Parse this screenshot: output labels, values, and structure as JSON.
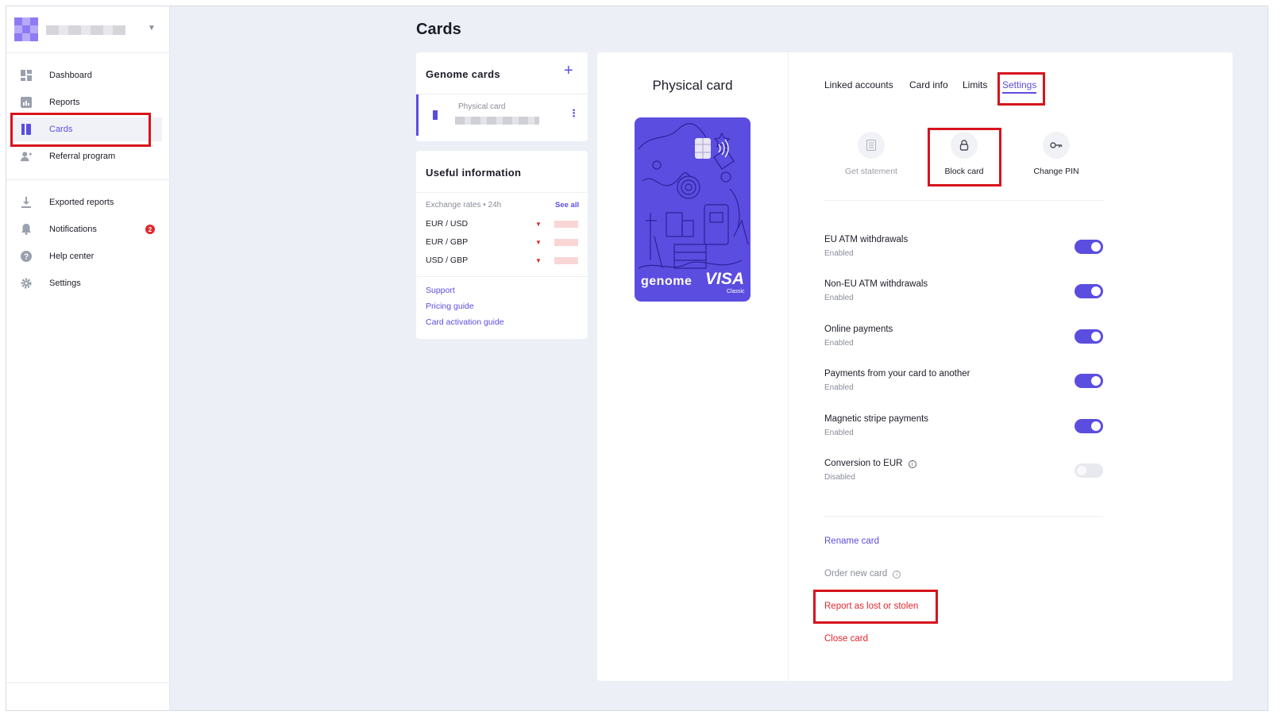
{
  "sidebar": {
    "nav_primary": [
      {
        "label": "Dashboard",
        "icon": "dashboard-icon"
      },
      {
        "label": "Reports",
        "icon": "reports-icon"
      },
      {
        "label": "Cards",
        "icon": "cards-icon",
        "active": true
      },
      {
        "label": "Referral program",
        "icon": "referral-icon"
      }
    ],
    "nav_secondary": [
      {
        "label": "Exported reports",
        "icon": "download-icon"
      },
      {
        "label": "Notifications",
        "icon": "bell-icon",
        "badge": "2"
      },
      {
        "label": "Help center",
        "icon": "help-icon"
      },
      {
        "label": "Settings",
        "icon": "gear-icon"
      }
    ]
  },
  "page": {
    "title": "Cards"
  },
  "genome_cards": {
    "title": "Genome cards",
    "add_symbol": "+",
    "card_label": "Physical card",
    "menu_symbol": "⋮"
  },
  "useful_info": {
    "title": "Useful information",
    "rates_label": "Exchange rates • 24h",
    "see_all": "See all",
    "pairs": [
      "EUR / USD",
      "EUR / GBP",
      "USD / GBP"
    ],
    "links": [
      "Support",
      "Pricing guide",
      "Card activation guide"
    ]
  },
  "card_preview": {
    "title": "Physical card",
    "brand": "genome",
    "network": "VISA",
    "network_sub": "Classic"
  },
  "tabs": [
    "Linked accounts",
    "Card info",
    "Limits",
    "Settings"
  ],
  "actions": [
    {
      "label": "Get statement",
      "icon": "statement-icon",
      "disabled": true
    },
    {
      "label": "Block card",
      "icon": "lock-icon"
    },
    {
      "label": "Change PIN",
      "icon": "key-icon"
    }
  ],
  "settings": [
    {
      "label": "EU ATM withdrawals",
      "status": "Enabled",
      "on": true
    },
    {
      "label": "Non-EU ATM withdrawals",
      "status": "Enabled",
      "on": true
    },
    {
      "label": "Online payments",
      "status": "Enabled",
      "on": true
    },
    {
      "label": "Payments from your card to another",
      "status": "Enabled",
      "on": true
    },
    {
      "label": "Magnetic stripe payments",
      "status": "Enabled",
      "on": true
    },
    {
      "label": "Conversion to EUR",
      "status": "Disabled",
      "on": false
    }
  ],
  "card_actions": {
    "rename": "Rename card",
    "order_new": "Order new card",
    "report": "Report as lost or stolen",
    "close": "Close card"
  },
  "colors": {
    "accent": "#5b4de0",
    "danger": "#e3262d",
    "highlight": "#d7131c"
  }
}
